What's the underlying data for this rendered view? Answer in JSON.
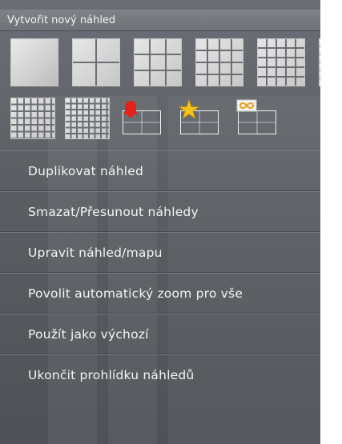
{
  "menu": {
    "header": "Vytvořit nový náhled",
    "layouts_row1": [
      {
        "icon": "layout-1x1-icon",
        "class": "n1"
      },
      {
        "icon": "layout-2x2-icon",
        "class": "n4"
      },
      {
        "icon": "layout-3x3-icon",
        "class": "n9"
      },
      {
        "icon": "layout-4x4-icon",
        "class": "n16"
      },
      {
        "icon": "layout-5x5-icon",
        "class": "n25"
      },
      {
        "icon": "layout-6x6-icon",
        "class": "n36"
      }
    ],
    "layouts_row2": [
      {
        "icon": "layout-7x7-icon",
        "class": "n49"
      },
      {
        "icon": "layout-8x8-icon",
        "class": "n64"
      }
    ],
    "special_views": [
      {
        "icon": "alarm-bell-view-icon"
      },
      {
        "icon": "favorite-star-view-icon"
      },
      {
        "icon": "carousel-loop-view-icon"
      }
    ],
    "items": [
      {
        "name": "duplicate-view-item",
        "label": "Duplikovat náhled"
      },
      {
        "name": "delete-move-views-item",
        "label": "Smazat/Přesunout náhledy"
      },
      {
        "name": "edit-view-map-item",
        "label": "Upravit náhled/mapu"
      },
      {
        "name": "enable-auto-zoom-item",
        "label": "Povolit automatický zoom pro vše"
      },
      {
        "name": "use-as-default-item",
        "label": "Použít jako výchozí"
      },
      {
        "name": "end-views-tour-item",
        "label": "Ukončit prohlídku náhledů"
      }
    ],
    "colors": {
      "alarm": "#e2231a",
      "star": "#f7c21a",
      "loop": "#e8c038"
    }
  }
}
